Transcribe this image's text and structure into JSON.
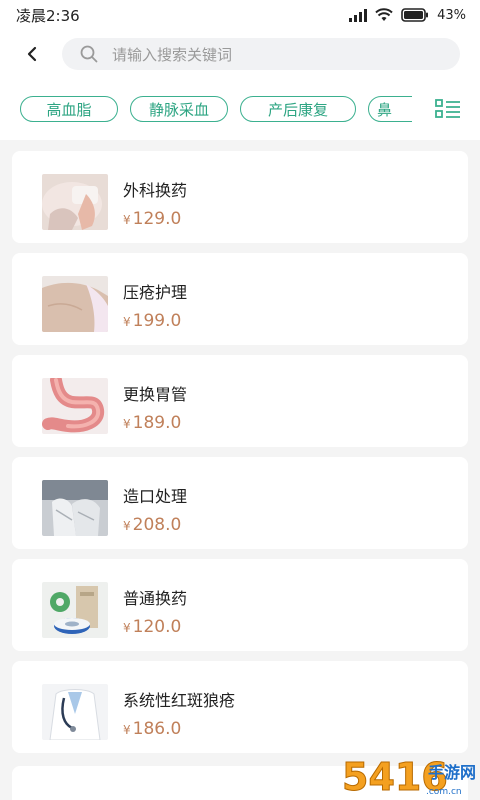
{
  "status_bar": {
    "time": "凌晨2:36",
    "battery": "43%"
  },
  "search": {
    "placeholder": "请输入搜索关键词"
  },
  "tags": [
    "高血脂",
    "静脉采血",
    "产后康复",
    "鼻"
  ],
  "products": [
    {
      "name": "外科换药",
      "price": "129.0",
      "thumb": "bandage-hand-image"
    },
    {
      "name": "压疮护理",
      "price": "199.0",
      "thumb": "patient-body-image"
    },
    {
      "name": "更换胃管",
      "price": "189.0",
      "thumb": "stomach-image"
    },
    {
      "name": "造口处理",
      "price": "208.0",
      "thumb": "gloved-hands-image"
    },
    {
      "name": "普通换药",
      "price": "120.0",
      "thumb": "medical-tape-image"
    },
    {
      "name": "系统性红斑狼疮",
      "price": "186.0",
      "thumb": "doctor-stethoscope-image"
    }
  ],
  "currency_symbol": "¥",
  "watermark": {
    "text": "5416手游网",
    "subtext": "www.5416.com.cn"
  },
  "colors": {
    "accent": "#3bb08f",
    "price": "#c0805a"
  }
}
